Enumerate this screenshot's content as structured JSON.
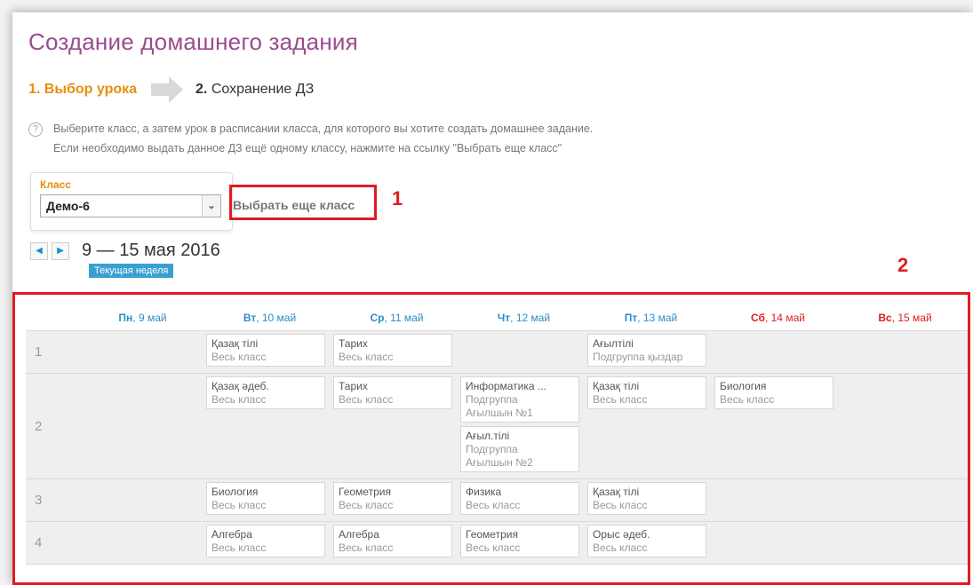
{
  "page": {
    "title": "Создание домашнего задания"
  },
  "steps": {
    "step1": "1. Выбор урока",
    "step2_num": "2.",
    "step2_label": "Сохранение ДЗ"
  },
  "help": {
    "line1": "Выберите класс, а затем урок в расписании класса, для которого вы хотите создать домашнее задание.",
    "line2": "Если необходимо выдать данное ДЗ ещё одному классу, нажмите на ссылку \"Выбрать еще класс\""
  },
  "class_select": {
    "label": "Класс",
    "value": "Демо-6"
  },
  "choose_more_link": "Выбрать еще класс",
  "annotations": {
    "num1": "1",
    "num2": "2",
    "color": "#e11b22"
  },
  "week": {
    "label": "9 — 15 мая 2016",
    "current_badge": "Текущая неделя"
  },
  "schedule": {
    "days": [
      {
        "abbr": "Пн",
        "date": ", 9 май",
        "weekend": false
      },
      {
        "abbr": "Вт",
        "date": ", 10 май",
        "weekend": false
      },
      {
        "abbr": "Ср",
        "date": ", 11 май",
        "weekend": false
      },
      {
        "abbr": "Чт",
        "date": ", 12 май",
        "weekend": false
      },
      {
        "abbr": "Пт",
        "date": ", 13 май",
        "weekend": false
      },
      {
        "abbr": "Сб",
        "date": ", 14 май",
        "weekend": true
      },
      {
        "abbr": "Вс",
        "date": ", 15 май",
        "weekend": true
      }
    ],
    "rows": [
      {
        "num": "1",
        "cells": [
          [],
          [
            {
              "subject": "Қазақ тілі",
              "group": [
                "Весь класс"
              ]
            }
          ],
          [
            {
              "subject": "Тарих",
              "group": [
                "Весь класс"
              ]
            }
          ],
          [],
          [
            {
              "subject": "Ағылтілі",
              "group": [
                "Подгруппа қыздар"
              ]
            }
          ],
          [],
          []
        ]
      },
      {
        "num": "2",
        "cells": [
          [],
          [
            {
              "subject": "Қазақ әдеб.",
              "group": [
                "Весь класс"
              ]
            }
          ],
          [
            {
              "subject": "Тарих",
              "group": [
                "Весь класс"
              ]
            }
          ],
          [
            {
              "subject": "Информатика ...",
              "group": [
                "Подгруппа",
                "Ағылшын №1"
              ]
            },
            {
              "subject": "Ағыл.тілі",
              "group": [
                "Подгруппа",
                "Ағылшын №2"
              ]
            }
          ],
          [
            {
              "subject": "Қазақ тілі",
              "group": [
                "Весь класс"
              ]
            }
          ],
          [
            {
              "subject": "Биология",
              "group": [
                "Весь класс"
              ]
            }
          ],
          []
        ]
      },
      {
        "num": "3",
        "cells": [
          [],
          [
            {
              "subject": "Биология",
              "group": [
                "Весь класс"
              ]
            }
          ],
          [
            {
              "subject": "Геометрия",
              "group": [
                "Весь класс"
              ]
            }
          ],
          [
            {
              "subject": "Физика",
              "group": [
                "Весь класс"
              ]
            }
          ],
          [
            {
              "subject": "Қазақ тілі",
              "group": [
                "Весь класс"
              ]
            }
          ],
          [],
          []
        ]
      },
      {
        "num": "4",
        "cells": [
          [],
          [
            {
              "subject": "Алгебра",
              "group": [
                "Весь класс"
              ]
            }
          ],
          [
            {
              "subject": "Алгебра",
              "group": [
                "Весь класс"
              ]
            }
          ],
          [
            {
              "subject": "Геометрия",
              "group": [
                "Весь класс"
              ]
            }
          ],
          [
            {
              "subject": "Орыс әдеб.",
              "group": [
                "Весь класс"
              ]
            }
          ],
          [],
          []
        ]
      }
    ]
  }
}
